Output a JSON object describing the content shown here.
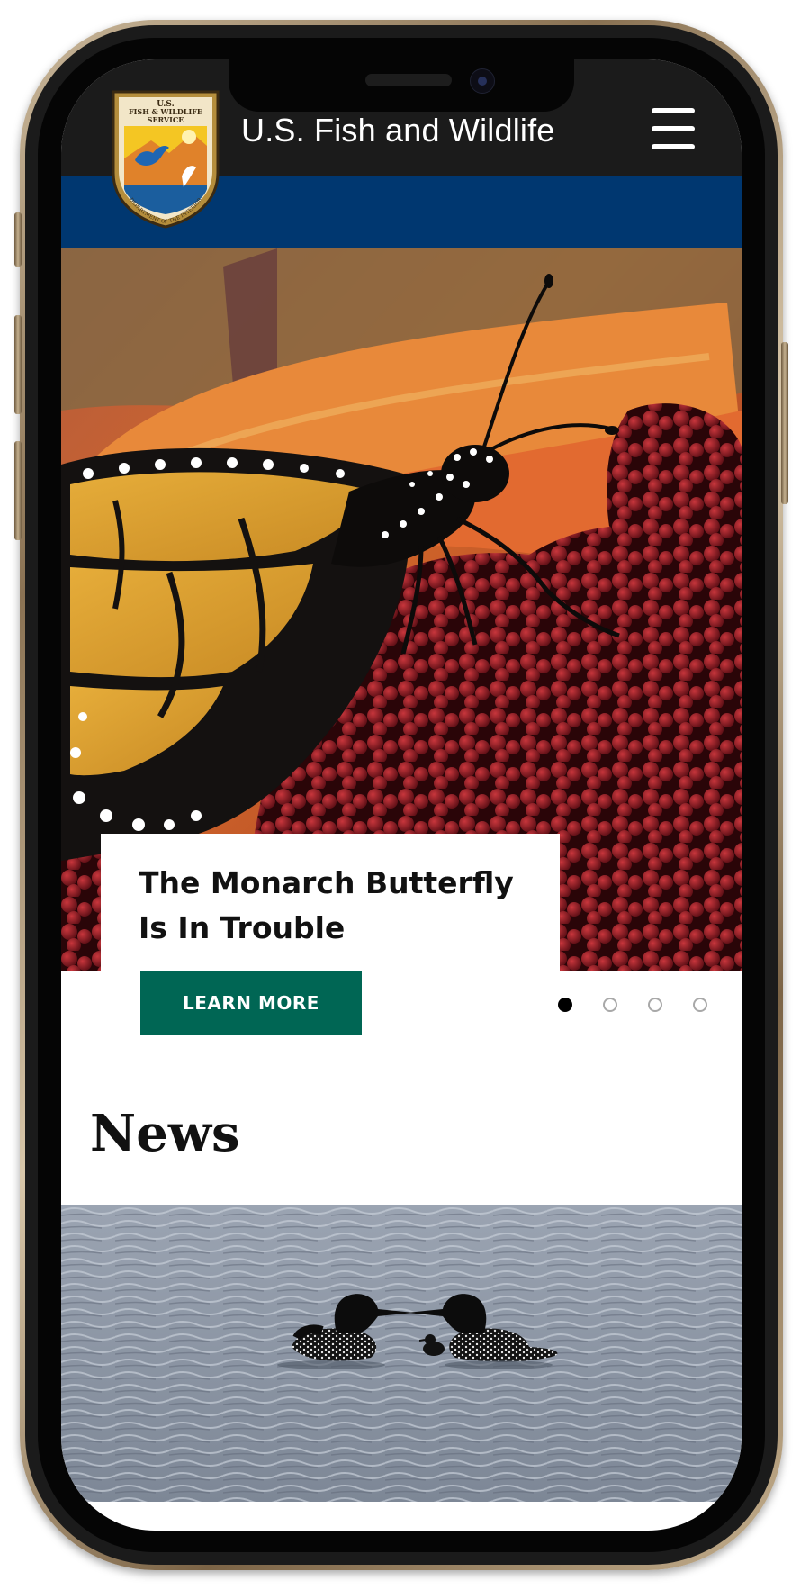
{
  "header": {
    "site_title": "U.S. Fish and Wildlife",
    "logo": {
      "line1": "U.S.",
      "line2": "FISH & WILDLIFE",
      "line3": "SERVICE",
      "arc_text": "DEPARTMENT OF THE INTERIOR"
    },
    "menu_icon": "hamburger-menu-icon"
  },
  "hero": {
    "headline_line1": "The Monarch Butterfly",
    "headline_line2": "Is In Trouble",
    "cta_label": "LEARN MORE",
    "image_subject": "monarch butterfly on red sumac berries",
    "carousel": {
      "total_slides": 4,
      "active_index": 0
    }
  },
  "news": {
    "heading": "News",
    "image_subject": "two loons with chick on lake water"
  },
  "colors": {
    "header_bg": "#1b1b1b",
    "band_blue": "#003770",
    "cta_green": "#006654",
    "frame_gold": "#b8a27f"
  }
}
